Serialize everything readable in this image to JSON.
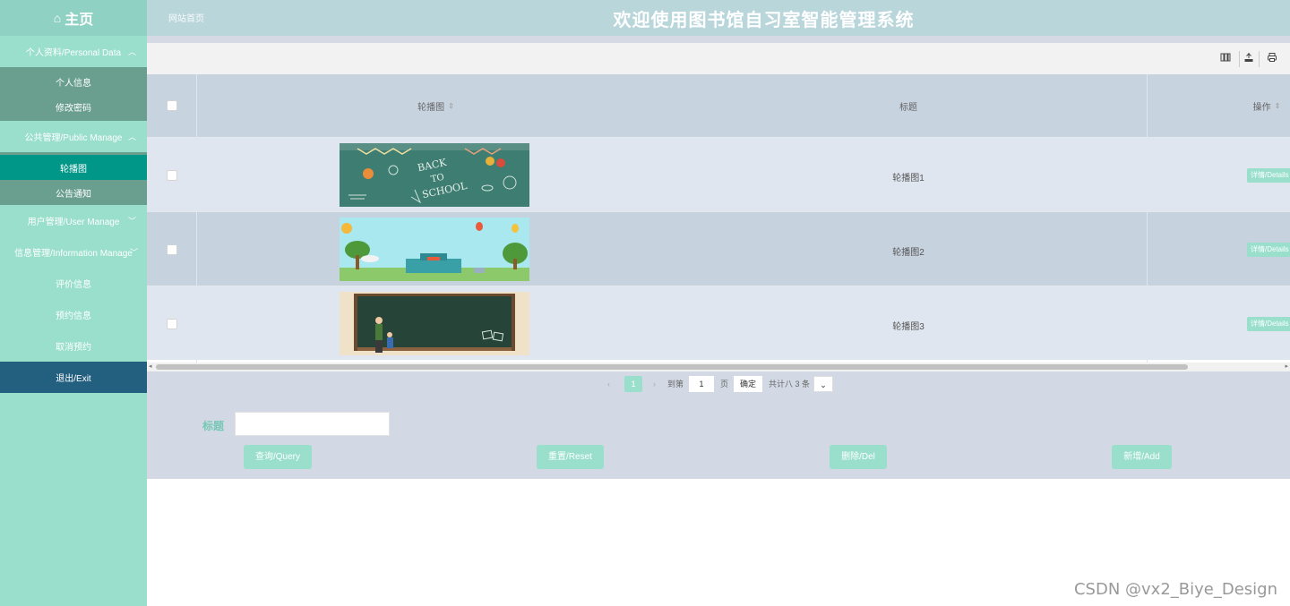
{
  "header": {
    "brand_icon": "home-icon",
    "brand_label": "主页",
    "site_link": "网站首页",
    "system_title": "欢迎使用图书馆自习室智能管理系统"
  },
  "sidebar": {
    "groups": [
      {
        "label": "个人资料/Personal Data",
        "items": [
          "个人信息",
          "修改密码"
        ]
      },
      {
        "label": "公共管理/Public Manage",
        "items": [
          "轮播图",
          "公告通知"
        ]
      },
      {
        "label": "用户管理/User Manage"
      },
      {
        "label": "信息管理/Information Manage",
        "items": [
          "评价信息",
          "预约信息",
          "取消预约"
        ]
      }
    ],
    "exit_label": "退出/Exit"
  },
  "toolbar": {
    "icons": [
      "columns-icon",
      "export-icon",
      "print-icon"
    ]
  },
  "table": {
    "columns": [
      "轮播图",
      "标题",
      "操作"
    ],
    "rows": [
      {
        "title": "轮播图1",
        "action": "详情/Details",
        "image": "back-to-school-chalkboard"
      },
      {
        "title": "轮播图2",
        "action": "详情/Details",
        "image": "school-building-cartoon"
      },
      {
        "title": "轮播图3",
        "action": "详情/Details",
        "image": "teacher-blackboard"
      }
    ]
  },
  "pager": {
    "prev": "‹",
    "current": "1",
    "next": "›",
    "goto_label": "到第",
    "goto_value": "1",
    "page_unit": "页",
    "confirm": "确定",
    "total": "共计八 3 条"
  },
  "search": {
    "title_label": "标题",
    "title_value": "",
    "buttons": {
      "query": "查询/Query",
      "reset": "重置/Reset",
      "delete": "删除/Del",
      "add": "新增/Add"
    }
  },
  "watermark": "CSDN @vx2_Biye_Design",
  "colors": {
    "accent": "#99dfcc",
    "active_menu": "#009688",
    "exit": "#235f7f",
    "header": "#b9d6db"
  }
}
